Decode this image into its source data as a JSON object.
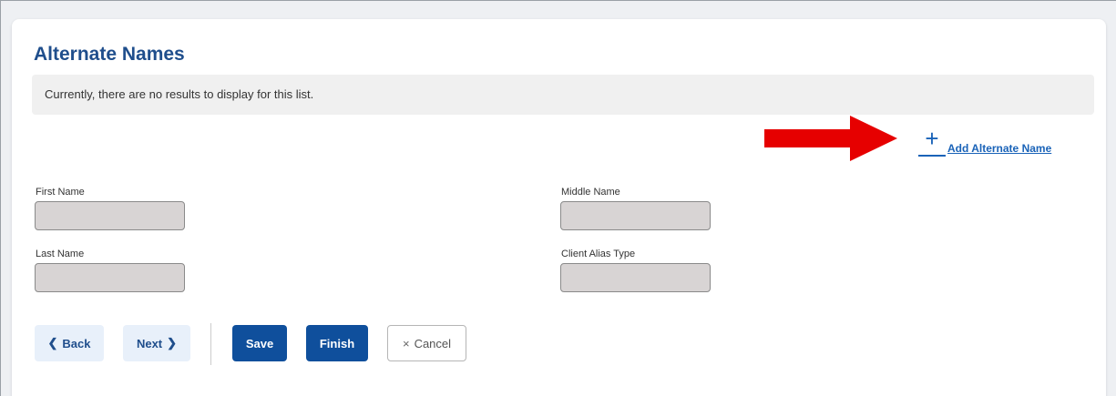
{
  "section": {
    "title": "Alternate Names",
    "empty_message": "Currently, there are no results to display for this list."
  },
  "add_link": {
    "label": "Add Alternate Name",
    "icon": "plus-icon"
  },
  "annotation": {
    "icon": "red-arrow-icon",
    "color": "#e60000"
  },
  "fields": {
    "first_name": {
      "label": "First Name",
      "value": ""
    },
    "middle_name": {
      "label": "Middle Name",
      "value": ""
    },
    "last_name": {
      "label": "Last Name",
      "value": ""
    },
    "client_alias_type": {
      "label": "Client Alias Type",
      "value": ""
    }
  },
  "buttons": {
    "back": {
      "label": "Back",
      "icon": "chevron-left-icon"
    },
    "next": {
      "label": "Next",
      "icon": "chevron-right-icon"
    },
    "save": {
      "label": "Save"
    },
    "finish": {
      "label": "Finish"
    },
    "cancel": {
      "label": "Cancel",
      "icon": "close-icon"
    }
  },
  "colors": {
    "accent": "#1f4e8c",
    "primary_button": "#0f4f9c",
    "link": "#1a63b8",
    "input_bg": "#d8d4d4"
  }
}
